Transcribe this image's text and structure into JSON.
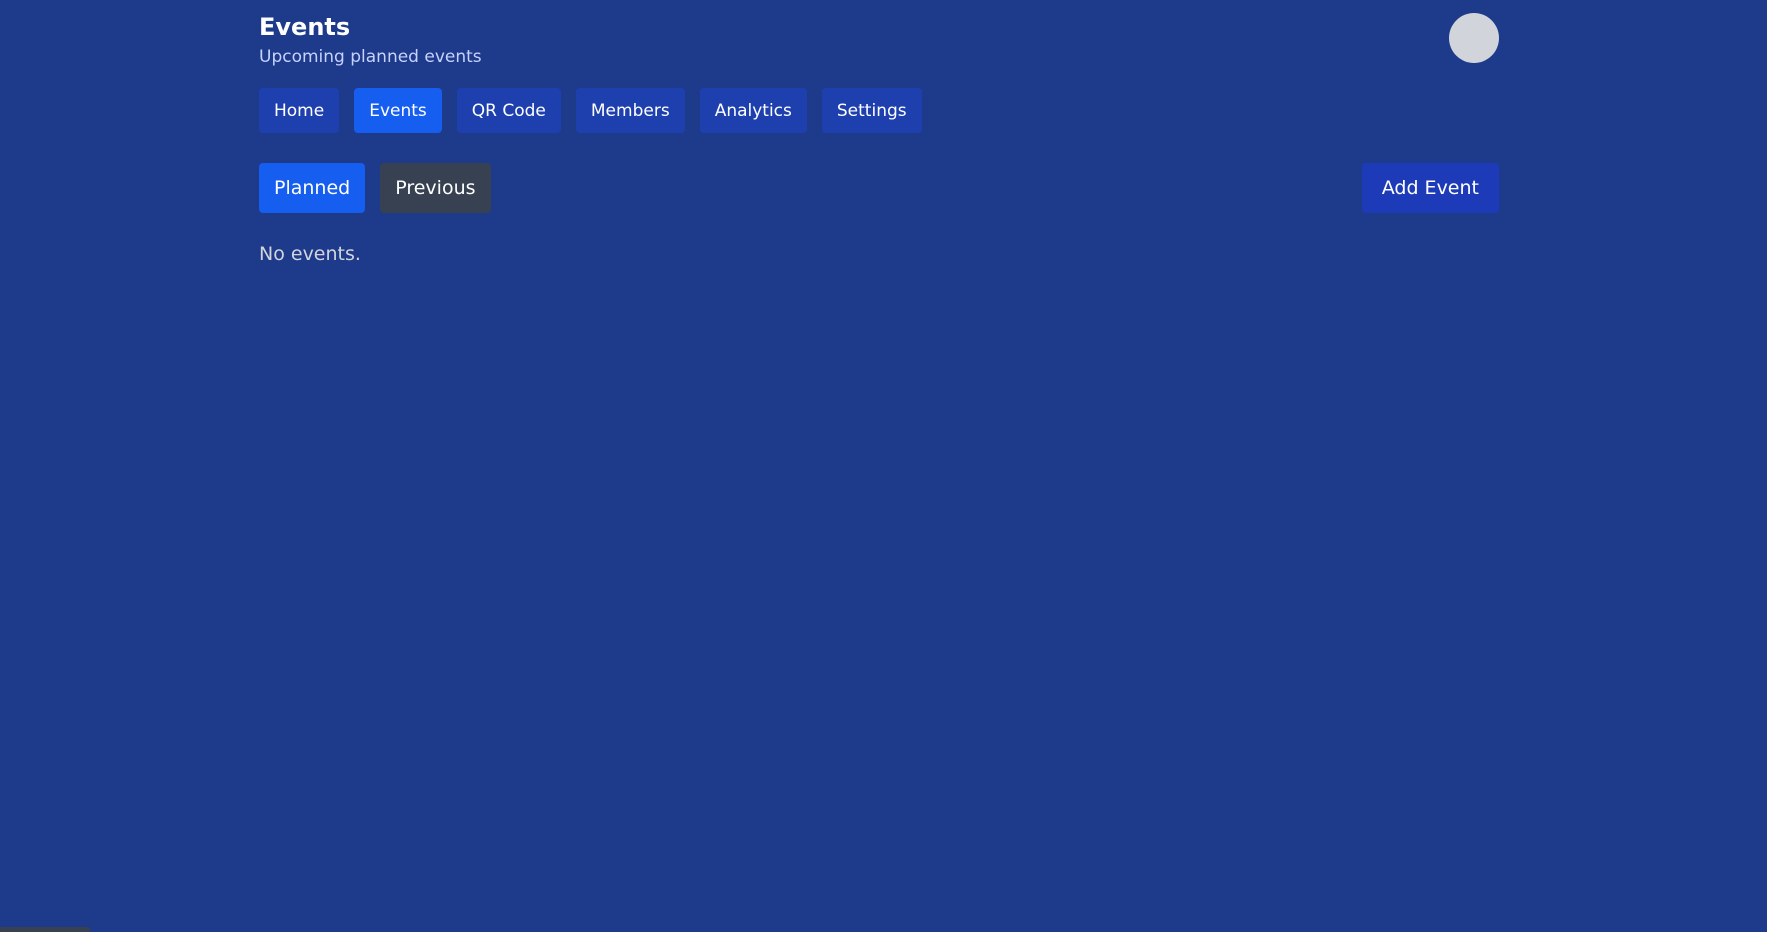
{
  "header": {
    "title": "Events",
    "subtitle": "Upcoming planned events"
  },
  "nav": {
    "items": [
      {
        "label": "Home",
        "active": false
      },
      {
        "label": "Events",
        "active": true
      },
      {
        "label": "QR Code",
        "active": false
      },
      {
        "label": "Members",
        "active": false
      },
      {
        "label": "Analytics",
        "active": false
      },
      {
        "label": "Settings",
        "active": false
      }
    ]
  },
  "filters": {
    "planned_label": "Planned",
    "previous_label": "Previous",
    "selected": "Planned"
  },
  "actions": {
    "add_event_label": "Add Event"
  },
  "content": {
    "empty_message": "No events."
  },
  "colors": {
    "background": "#1e3a8a",
    "nav_item": "#1e40af",
    "active": "#155eef",
    "previous_button": "#374151",
    "avatar": "#d1d5db"
  }
}
